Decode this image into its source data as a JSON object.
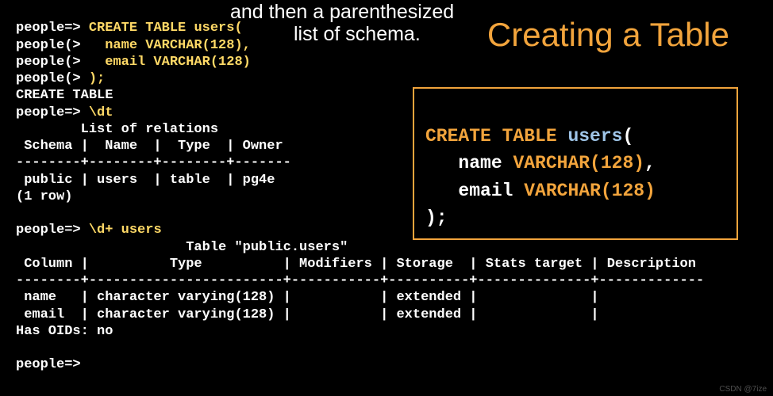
{
  "overlay": {
    "line1": "and then a parenthesized",
    "line2": "list of schema."
  },
  "title": "Creating a Table",
  "terminal": {
    "l1_prompt": "people=> ",
    "l1_cmd": "CREATE TABLE users(",
    "l2_prompt": "people(>   ",
    "l2_cmd": "name VARCHAR(128),",
    "l3_prompt": "people(>   ",
    "l3_cmd": "email VARCHAR(128)",
    "l4_prompt": "people(> ",
    "l4_cmd": ");",
    "l5": "CREATE TABLE",
    "l6_prompt": "people=> ",
    "l6_cmd": "\\dt",
    "l7": "        List of relations",
    "l8": " Schema |  Name  |  Type  | Owner",
    "l9": "--------+--------+--------+-------",
    "l10": " public | users  | table  | pg4e",
    "l11": "(1 row)",
    "l12": "",
    "l13_prompt": "people=> ",
    "l13_cmd": "\\d+ users",
    "l14": "                     Table \"public.users\"",
    "l15": " Column |          Type          | Modifiers | Storage  | Stats target | Description",
    "l16": "--------+------------------------+-----------+----------+--------------+-------------",
    "l17": " name   | character varying(128) |           | extended |              |",
    "l18": " email  | character varying(128) |           | extended |              |",
    "l19": "Has OIDs: no",
    "l20": "",
    "l21": "people=>"
  },
  "codebox": {
    "kw_create": "CREATE TABLE ",
    "tbl": "users",
    "paren_open": "(",
    "indent": "   ",
    "col1": "name ",
    "type1": "VARCHAR(128)",
    "comma": ",",
    "col2": "email ",
    "type2": "VARCHAR(128)",
    "close": ");"
  },
  "watermark": "CSDN @7ize"
}
